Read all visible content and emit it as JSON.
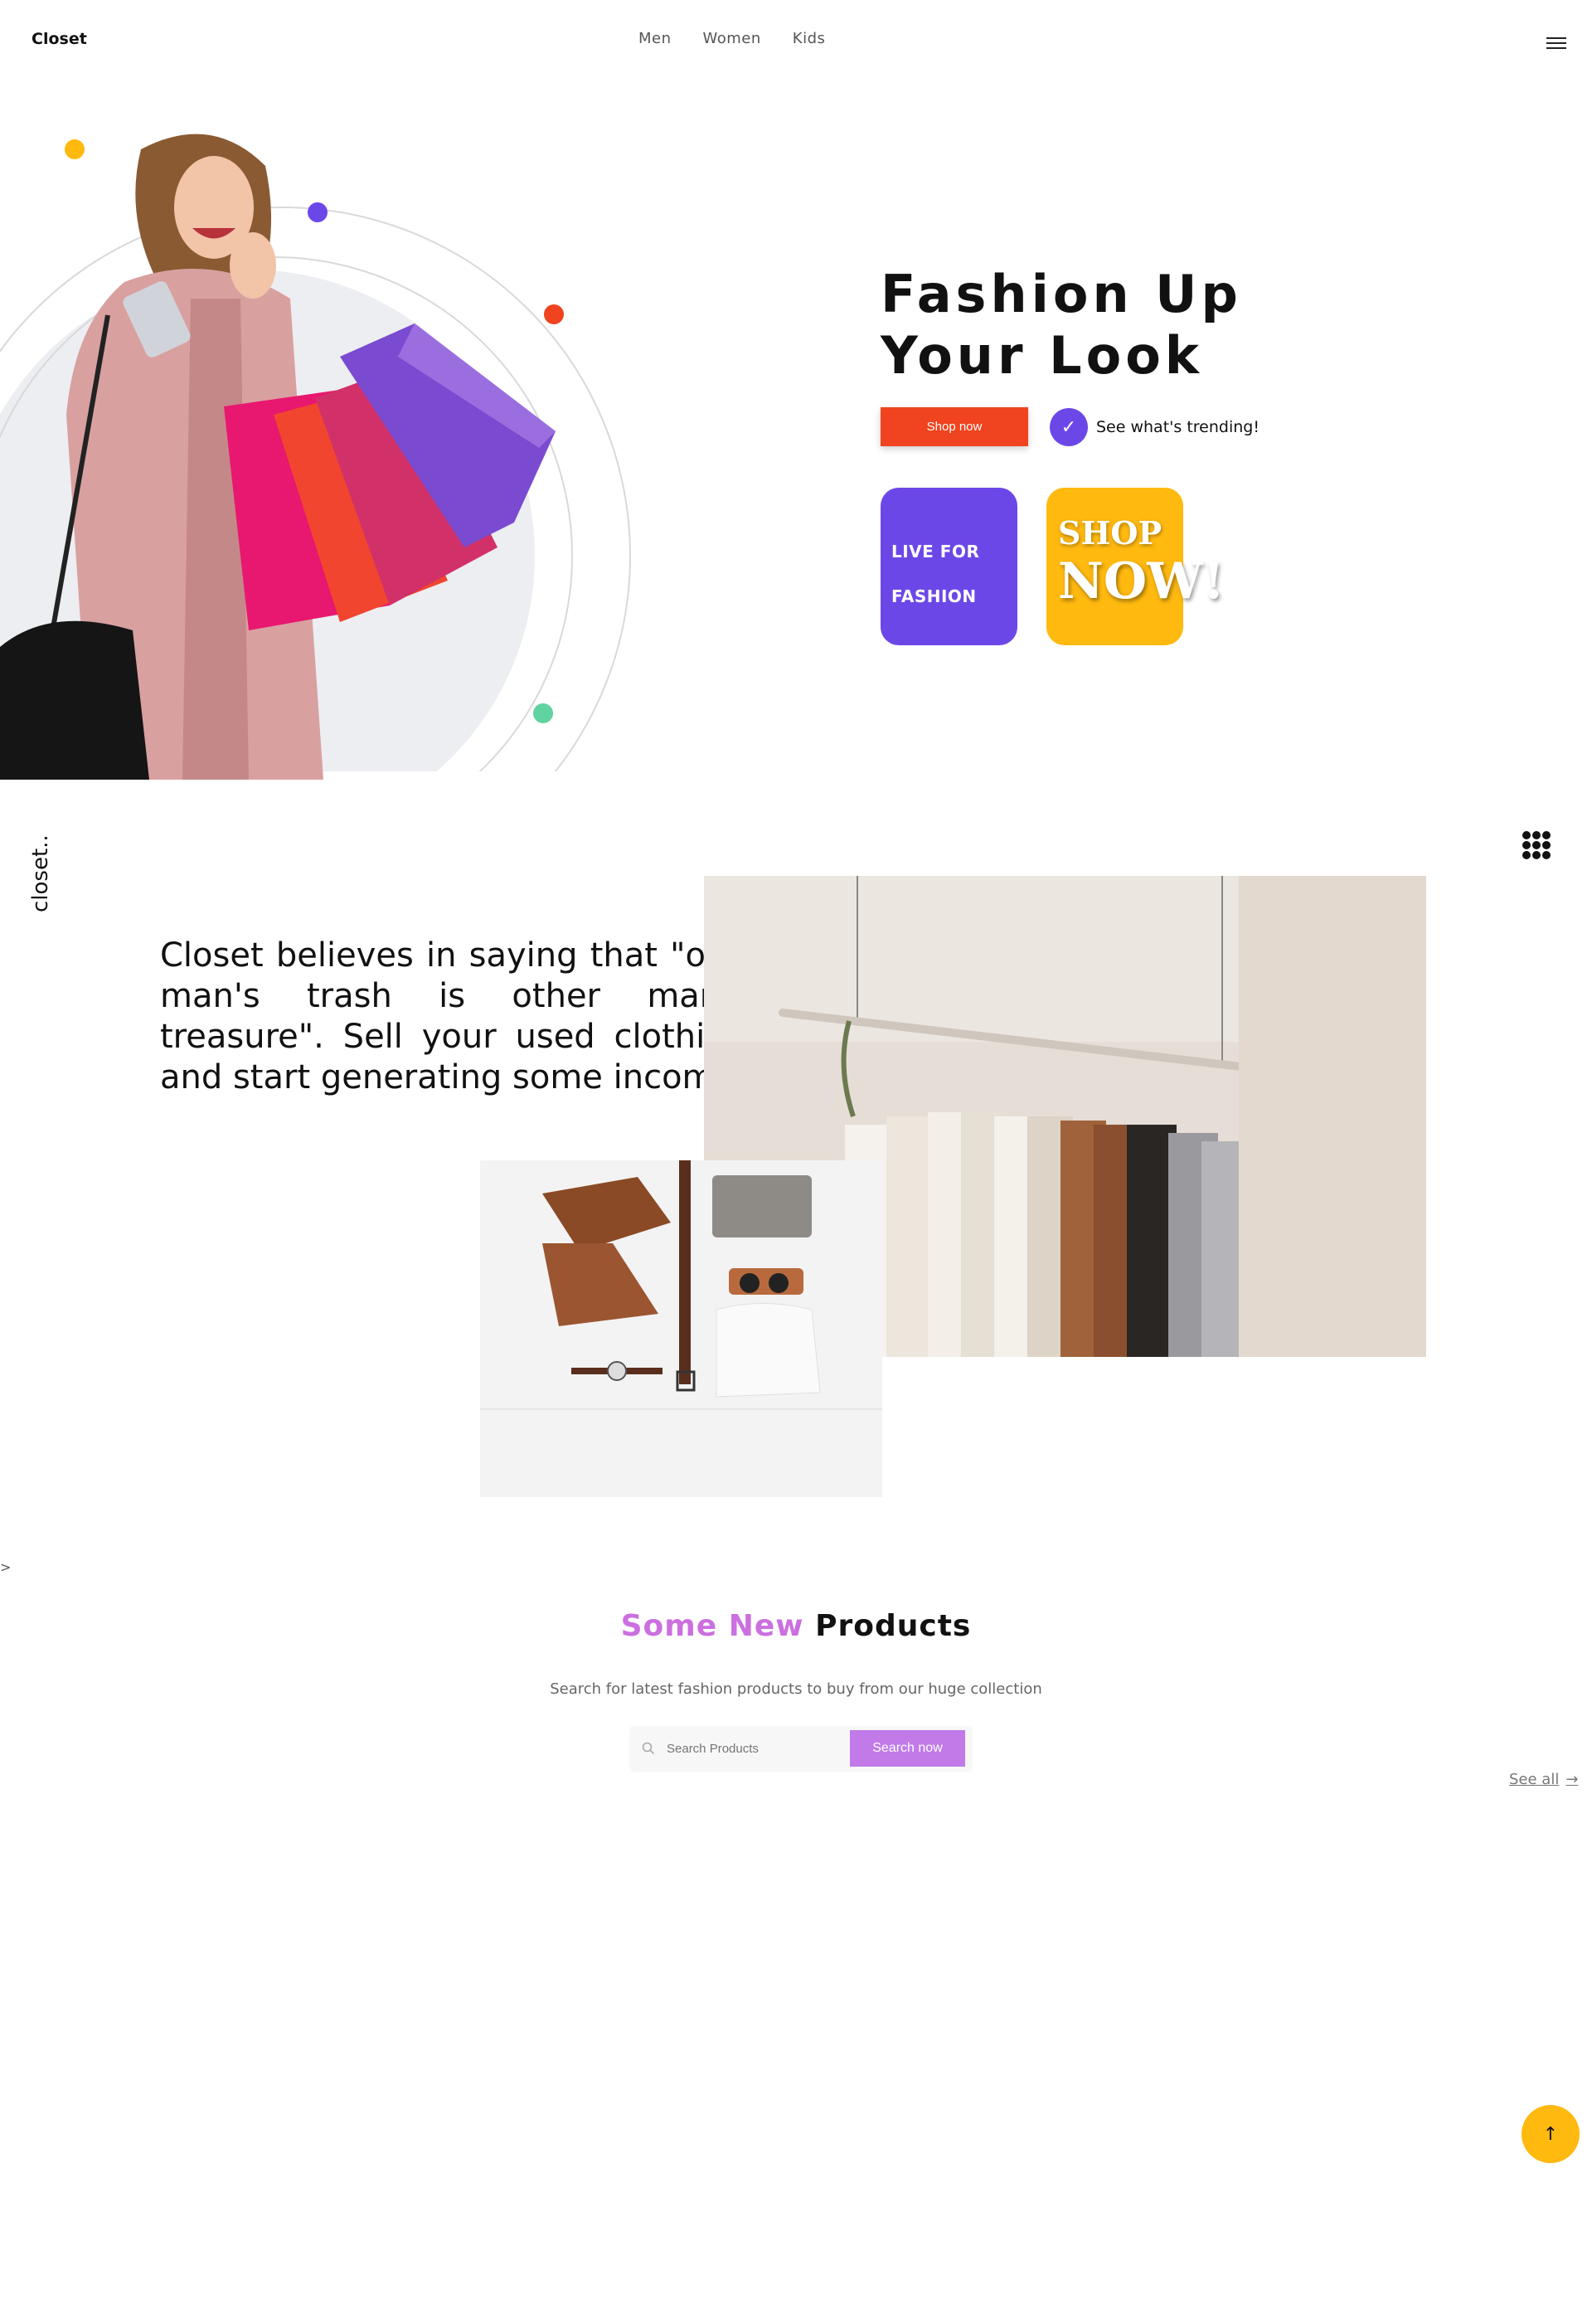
{
  "header": {
    "brand": "Closet",
    "nav": [
      "Men",
      "Women",
      "Kids"
    ]
  },
  "hero": {
    "title_line1": "Fashion Up",
    "title_line2": "Your Look",
    "shop_button": "Shop now",
    "trending_label": "See what's trending!",
    "card_purple_line1": "LIVE FOR",
    "card_purple_line2": "FASHION",
    "card_yellow_line1": "SHOP",
    "card_yellow_line2": "NOW!"
  },
  "about": {
    "side_label": "closet..",
    "quote": "Closet believes in saying that \"one man's trash is other man's treasure\". Sell your used clothing and start generating some income."
  },
  "products": {
    "title_highlight": "Some New",
    "title_rest": "Products",
    "subtitle": "Search for latest fashion products to buy from our huge collection",
    "search_placeholder": "Search Products",
    "search_button": "Search now",
    "see_all": "See all"
  },
  "colors": {
    "accent_red": "#f0431f",
    "accent_purple": "#6c47e8",
    "accent_yellow": "#ffb90f",
    "accent_pink": "#cc6fe0"
  },
  "icons": {
    "menu": "hamburger-menu-icon",
    "check": "check-icon",
    "grid": "grid-dots-icon",
    "search": "search-icon",
    "arrow": "arrow-right-icon",
    "scroll_top": "arrow-up-icon"
  }
}
